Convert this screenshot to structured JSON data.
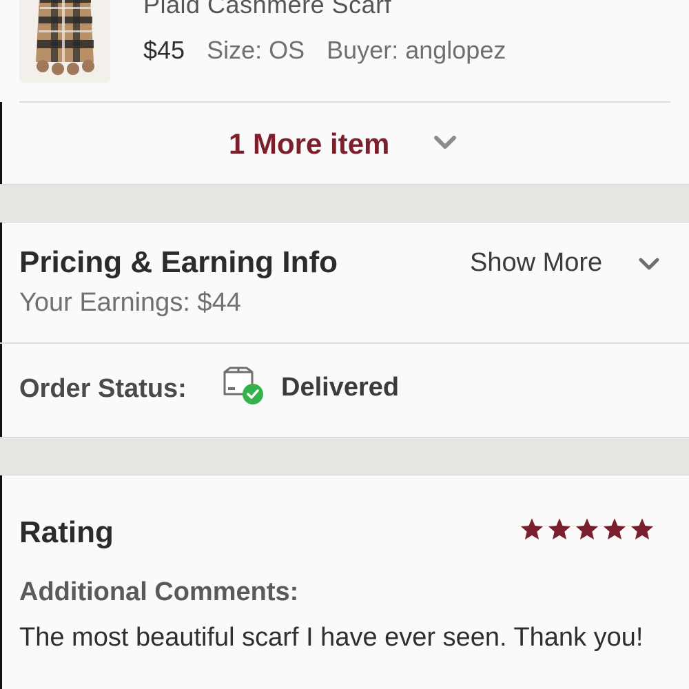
{
  "item": {
    "title": "Plaid Cashmere Scarf",
    "price": "$45",
    "size": "Size: OS",
    "buyer": "Buyer: anglopez",
    "thumbnail_icon": "plaid-scarf-thumbnail"
  },
  "more_items": {
    "label": "1 More item",
    "icon": "chevron-down-icon"
  },
  "pricing": {
    "title": "Pricing & Earning Info",
    "earnings": "Your Earnings: $44",
    "show_more": "Show More",
    "icon": "chevron-down-icon"
  },
  "order_status": {
    "label": "Order Status:",
    "value": "Delivered",
    "icon": "package-delivered-icon"
  },
  "rating": {
    "title": "Rating",
    "stars": 5,
    "max_stars": 5,
    "star_color": "#7a1f2b"
  },
  "comments": {
    "label": "Additional Comments:",
    "text": "The most beautiful scarf I have ever seen. Thank you!"
  },
  "colors": {
    "accent": "#7a1f2b",
    "success": "#34b34a",
    "band": "#e8e6e2"
  }
}
